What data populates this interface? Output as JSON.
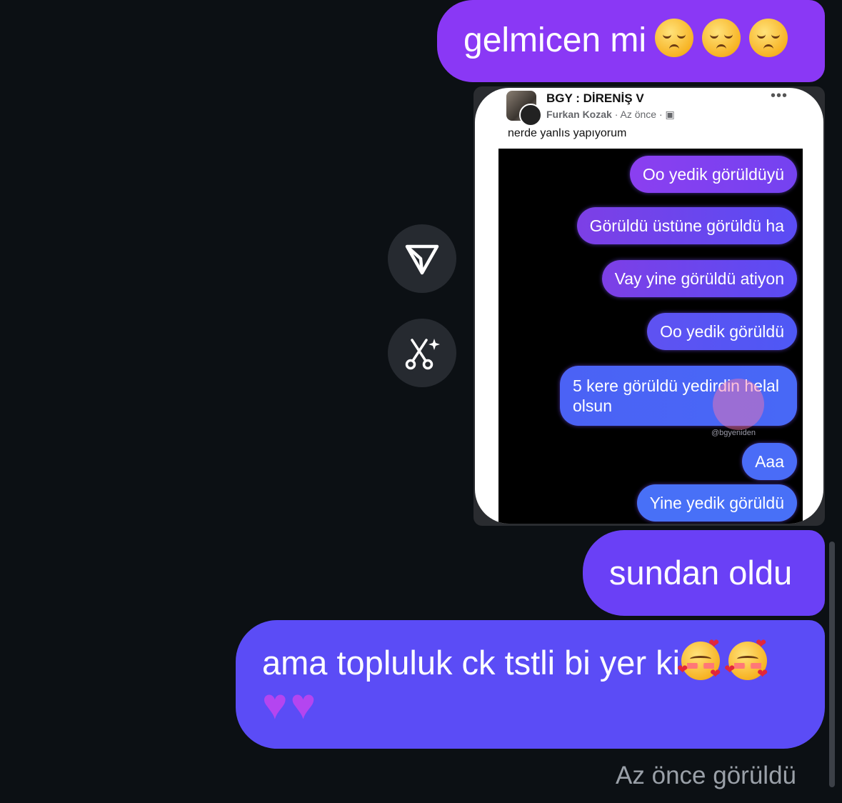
{
  "messages": {
    "m1_text": "gelmicen mi",
    "m1_emojis": [
      "pensive-face-emoji",
      "pensive-face-emoji",
      "pensive-face-emoji"
    ],
    "m3_text": "sundan oldu",
    "m4_text": "ama topluluk ck tstli bi yer ki",
    "m4_emojis": [
      "smiling-face-with-hearts-emoji",
      "smiling-face-with-hearts-emoji",
      "purple-heart-emoji",
      "purple-heart-emoji"
    ]
  },
  "shared_post": {
    "group_name": "BGY : DİRENİŞ V",
    "author": "Furkan Kozak",
    "time": "Az önce",
    "more_label": "•••",
    "caption": "nerde yanlıs yapıyorum",
    "image_messages": [
      "Oo yedik görüldüyü",
      "Görüldü üstüne görüldü ha",
      "Vay yine görüldü atiyon",
      "Oo yedik görüldü",
      "5 kere görüldü yedirdin helal olsun",
      "Aaa",
      "Yine yedik görüldü"
    ],
    "watermark_handle": "@bgyeniden"
  },
  "side_actions": {
    "share_icon": "send-icon",
    "remix_icon": "scissors-sparkle-icon"
  },
  "status": {
    "seen": "Az önce görüldü"
  },
  "colors": {
    "background": "#0c1014",
    "bubble_purple": "#8a38f5",
    "bubble_indigo": "#5b4cf6"
  }
}
